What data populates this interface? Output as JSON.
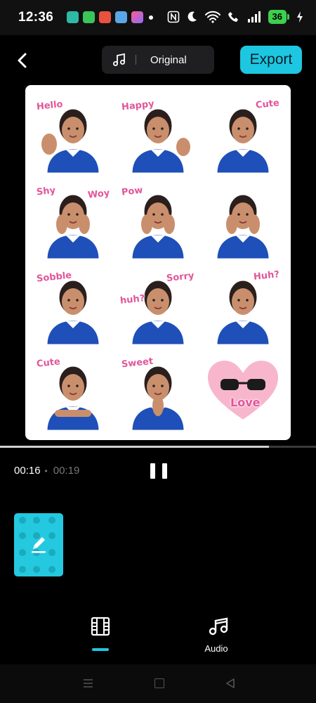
{
  "status_bar": {
    "time": "12:36",
    "battery_level": "36",
    "notification_apps": [
      "chat-app-icon",
      "calculator-app-icon",
      "photos-app-icon",
      "gallery-app-icon",
      "app-switcher-icon"
    ],
    "system_icons": [
      "nfc-icon",
      "moon-icon",
      "wifi-icon",
      "wifi-call-icon",
      "signal-icon",
      "battery-icon",
      "charging-icon"
    ]
  },
  "top_bar": {
    "audio_label": "Original",
    "export_label": "Export",
    "accent_color": "#1ec7e1"
  },
  "preview": {
    "stickers": [
      {
        "word": "Hello",
        "gesture": "wave"
      },
      {
        "word": "Happy",
        "gesture": "thumbs-up"
      },
      {
        "word": "Cute",
        "gesture": "none"
      },
      {
        "word": "Shy",
        "word2": "Woy",
        "gesture": "hands-on-cheeks"
      },
      {
        "word": "Pow",
        "gesture": "hands-on-cheeks"
      },
      {
        "word": "",
        "gesture": "hands-on-cheeks"
      },
      {
        "word": "Sobble",
        "gesture": "pout"
      },
      {
        "word": "Sorry",
        "word2": "huh?",
        "gesture": "pout"
      },
      {
        "word": "Huh?",
        "gesture": "pout"
      },
      {
        "word": "Cute",
        "gesture": "arms-crossed"
      },
      {
        "word": "Sweet",
        "gesture": "praying-hands"
      },
      {
        "word": "Love",
        "gesture": "heart-sunglasses"
      }
    ]
  },
  "playback": {
    "current_time": "00:16",
    "total_time": "00:19",
    "progress_fraction": 0.85
  },
  "toolbar": {
    "video_label": "",
    "audio_label": "Audio"
  }
}
